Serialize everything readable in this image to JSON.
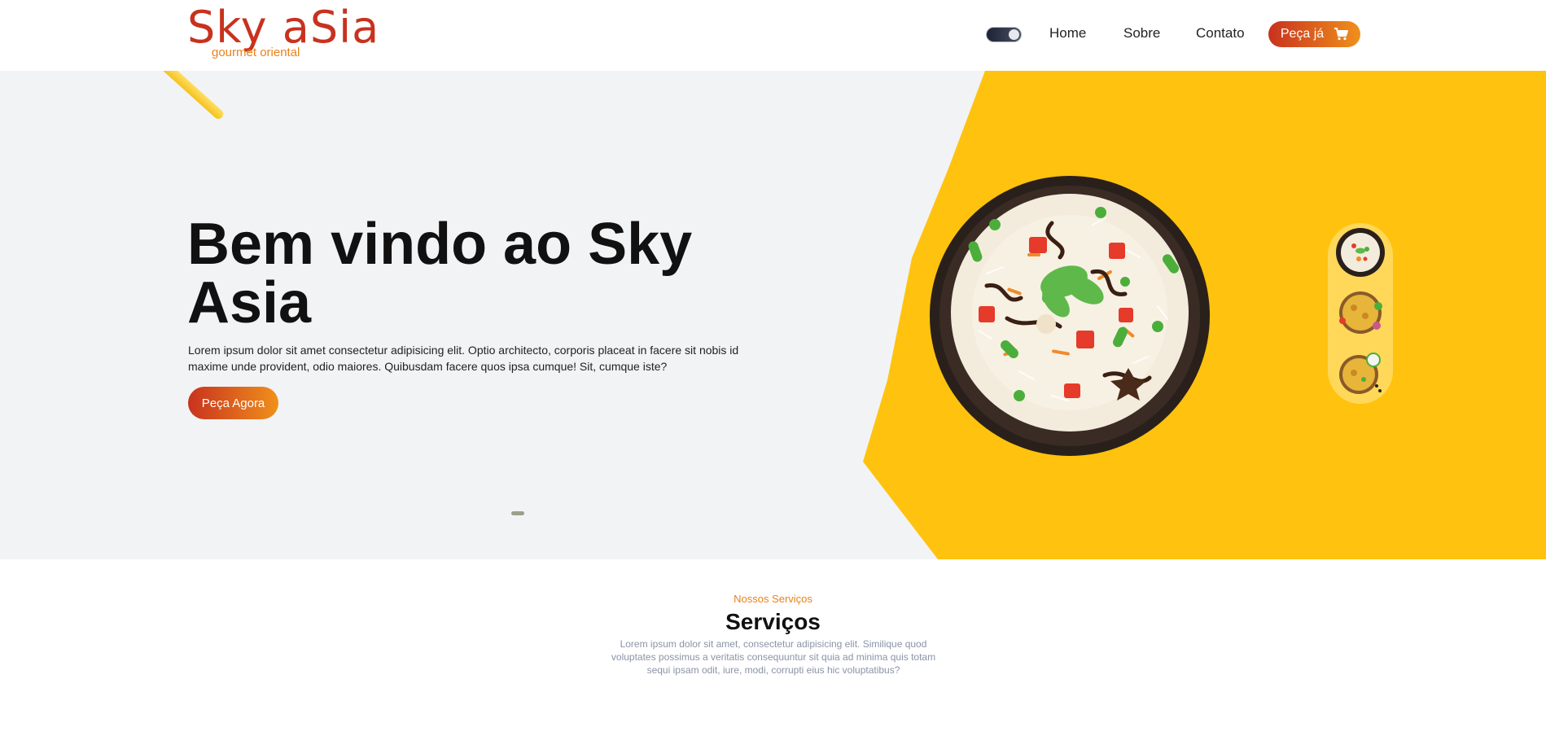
{
  "header": {
    "logo_main": "Sky aSia",
    "logo_sub": "gourmet oriental",
    "nav": {
      "home": "Home",
      "sobre": "Sobre",
      "contato": "Contato"
    },
    "order_button": "Peça já",
    "icons": {
      "cart": "cart-icon",
      "theme": "theme-toggle"
    }
  },
  "hero": {
    "title": "Bem vindo ao Sky Asia",
    "description": "Lorem ipsum dolor sit amet consectetur adipisicing elit. Optio architecto, corporis placeat in facere sit nobis id maxime unde provident, odio maiores. Quibusdam facere quos ipsa cumque! Sit, cumque iste?",
    "button": "Peça Agora"
  },
  "services": {
    "kicker": "Nossos Serviços",
    "title": "Serviços",
    "description": "Lorem ipsum dolor sit amet, consectetur adipisicing elit. Similique quod voluptates possimus a veritatis consequuntur sit quia ad minima quis totam sequi ipsam odit, iure, modi, corrupti eius hic voluptatibus?"
  },
  "colors": {
    "brand_red": "#c8321e",
    "brand_orange": "#f0901c",
    "hero_yellow": "#ffc20e",
    "hero_bg": "#f2f3f5",
    "thumb_strip": "#ffd85a"
  }
}
